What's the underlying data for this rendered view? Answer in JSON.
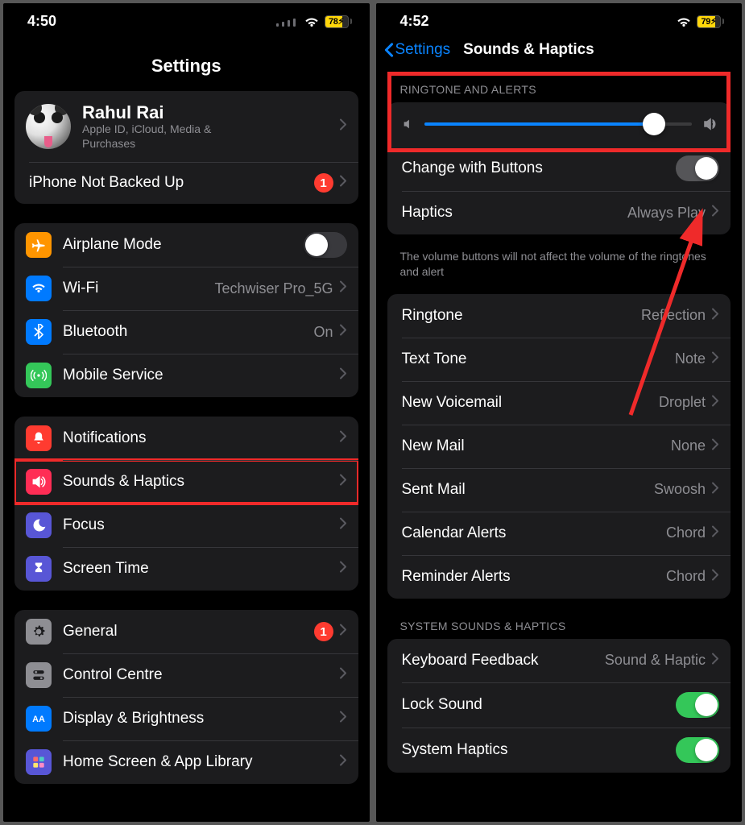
{
  "left": {
    "status": {
      "time": "4:50",
      "battery": "78"
    },
    "title": "Settings",
    "profile": {
      "name": "Rahul Rai",
      "sub": "Apple ID, iCloud, Media & Purchases",
      "backup": "iPhone Not Backed Up",
      "backup_badge": "1"
    },
    "g1": {
      "airplane": "Airplane Mode",
      "wifi": "Wi-Fi",
      "wifi_val": "Techwiser Pro_5G",
      "bt": "Bluetooth",
      "bt_val": "On",
      "mobile": "Mobile Service"
    },
    "g2": {
      "notif": "Notifications",
      "sounds": "Sounds & Haptics",
      "focus": "Focus",
      "screentime": "Screen Time"
    },
    "g3": {
      "general": "General",
      "general_badge": "1",
      "cc": "Control Centre",
      "disp": "Display & Brightness",
      "home": "Home Screen & App Library"
    }
  },
  "right": {
    "status": {
      "time": "4:52",
      "battery": "79"
    },
    "back": "Settings",
    "title": "Sounds & Haptics",
    "ring_hdr": "Ringtone and Alerts",
    "change_btn": "Change with Buttons",
    "haptics": "Haptics",
    "haptics_val": "Always Play",
    "foot": "The volume buttons will not affect the volume of the ringtones and alert",
    "tones": {
      "ringtone": "Ringtone",
      "ringtone_v": "Reflection",
      "text": "Text Tone",
      "text_v": "Note",
      "vm": "New Voicemail",
      "vm_v": "Droplet",
      "mail": "New Mail",
      "mail_v": "None",
      "sent": "Sent Mail",
      "sent_v": "Swoosh",
      "cal": "Calendar Alerts",
      "cal_v": "Chord",
      "rem": "Reminder Alerts",
      "rem_v": "Chord"
    },
    "sys_hdr": "System Sounds & Haptics",
    "sys": {
      "kbd": "Keyboard Feedback",
      "kbd_v": "Sound & Haptic",
      "lock": "Lock Sound",
      "hapt": "System Haptics"
    }
  }
}
